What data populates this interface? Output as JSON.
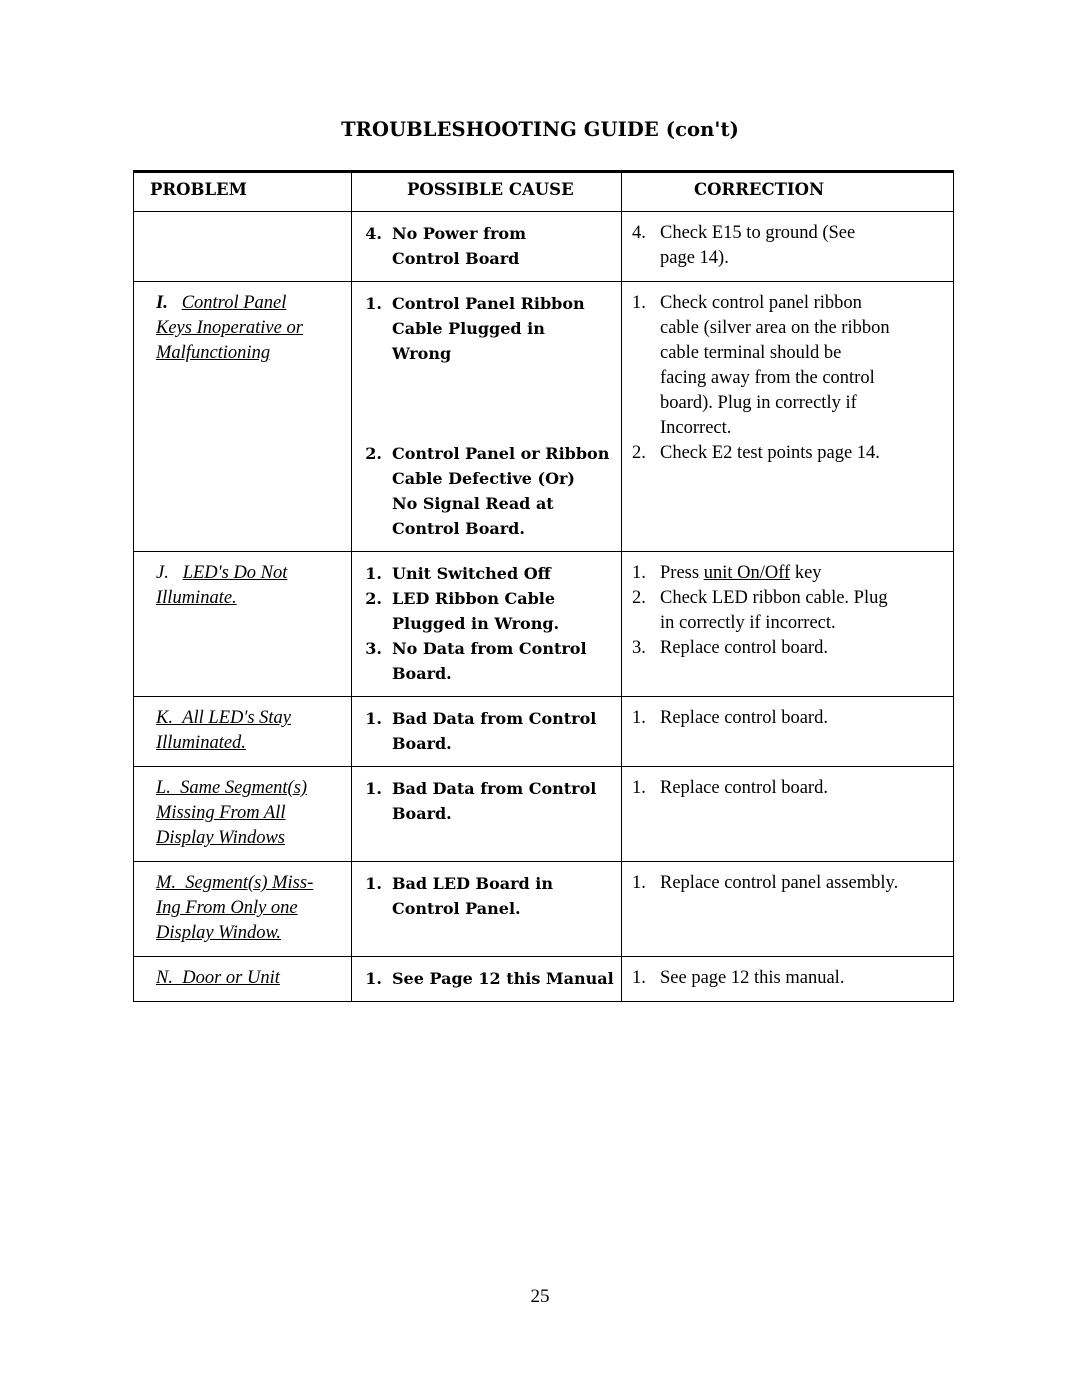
{
  "document": {
    "title": "TROUBLESHOOTING GUIDE (con't)",
    "page_number": "25"
  },
  "table": {
    "columns": [
      {
        "key": "problem",
        "label": "PROBLEM"
      },
      {
        "key": "cause",
        "label": "POSSIBLE CAUSE"
      },
      {
        "key": "correction",
        "label": "CORRECTION"
      }
    ],
    "rows": [
      {
        "problem": {
          "label": "",
          "lines": []
        },
        "cause": [
          {
            "num": "4.",
            "lines": [
              "No Power from",
              "Control Board"
            ]
          }
        ],
        "correction": [
          {
            "num": "4.",
            "lines": [
              "Check E15 to ground (See",
              "page 14)."
            ]
          }
        ]
      },
      {
        "problem": {
          "label": "I.",
          "lines": [
            "Control Panel",
            "Keys Inoperative or",
            "Malfunctioning"
          ]
        },
        "cause": [
          {
            "num": "1.",
            "lines": [
              "Control Panel Ribbon",
              "Cable Plugged in",
              "Wrong"
            ]
          },
          {
            "num": "2.",
            "lines": [
              "Control Panel or Ribbon",
              "Cable Defective (Or)",
              "No Signal Read at",
              "Control Board."
            ]
          }
        ],
        "correction": [
          {
            "num": "1.",
            "lines": [
              "Check control panel ribbon",
              "cable (silver area on the ribbon",
              "cable terminal should be",
              "facing away from the control",
              "board).  Plug in correctly if",
              "Incorrect."
            ]
          },
          {
            "num": "2.",
            "lines": [
              "Check E2 test points page 14."
            ]
          }
        ]
      },
      {
        "problem": {
          "label": "J.",
          "lines": [
            "LED's Do Not",
            "Illuminate."
          ]
        },
        "cause": [
          {
            "num": "1.",
            "lines": [
              "Unit Switched Off"
            ]
          },
          {
            "num": "2.",
            "lines": [
              "LED Ribbon Cable",
              "Plugged in Wrong."
            ]
          },
          {
            "num": "3.",
            "lines": [
              "No Data from Control",
              "Board."
            ]
          }
        ],
        "correction": [
          {
            "num": "1.",
            "lines": [
              "Press unit On/Off key"
            ]
          },
          {
            "num": "2.",
            "lines": [
              "Check LED ribbon cable.  Plug",
              "in correctly if incorrect."
            ]
          },
          {
            "num": "3.",
            "lines": [
              "Replace control board."
            ]
          }
        ]
      },
      {
        "problem": {
          "label": "K.",
          "lines": [
            "All LED's Stay",
            "Illuminated."
          ]
        },
        "cause": [
          {
            "num": "1.",
            "lines": [
              "Bad Data from Control",
              "Board."
            ]
          }
        ],
        "correction": [
          {
            "num": "1.",
            "lines": [
              "Replace control board."
            ]
          }
        ]
      },
      {
        "problem": {
          "label": "L.",
          "lines": [
            "Same Segment(s)",
            "Missing From All",
            "Display Windows"
          ]
        },
        "cause": [
          {
            "num": "1.",
            "lines": [
              "Bad Data from Control",
              "Board."
            ]
          }
        ],
        "correction": [
          {
            "num": "1.",
            "lines": [
              "Replace control board."
            ]
          }
        ]
      },
      {
        "problem": {
          "label": "M.",
          "lines": [
            "Segment(s) Miss-",
            "Ing From Only one",
            "Display Window."
          ]
        },
        "cause": [
          {
            "num": "1.",
            "lines": [
              "Bad LED Board in",
              "Control Panel."
            ]
          }
        ],
        "correction": [
          {
            "num": "1.",
            "lines": [
              "Replace control panel assembly."
            ]
          }
        ]
      },
      {
        "problem": {
          "label": "N.",
          "lines": [
            "Door or Unit"
          ]
        },
        "cause": [
          {
            "num": "1.",
            "lines": [
              "See Page 12 this Manual"
            ]
          }
        ],
        "correction": [
          {
            "num": "1.",
            "lines": [
              "See page 12 this manual."
            ]
          }
        ]
      }
    ]
  }
}
